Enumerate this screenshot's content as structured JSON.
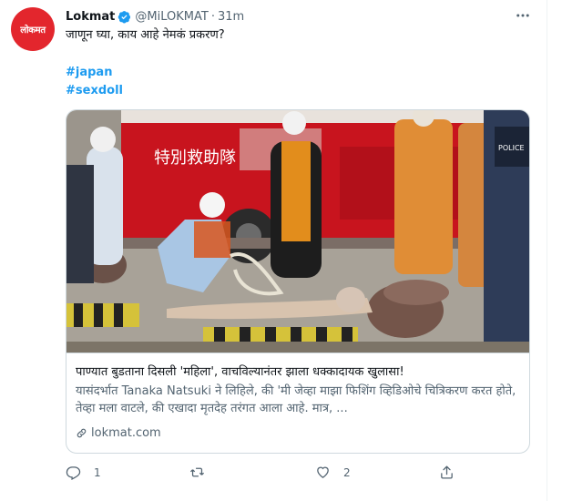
{
  "tweet": {
    "author": {
      "avatar_text": "लोकमत",
      "name": "Lokmat",
      "verified_icon": "verified-badge-icon",
      "handle": "@MiLOKMAT",
      "separator": "·",
      "time": "31m"
    },
    "more_icon": "ellipsis-icon",
    "text": "जाणून घ्या, काय आहे नेमकं प्रकरण?",
    "hashtags": [
      "#japan",
      "#sexdoll"
    ],
    "card": {
      "title": "पाण्यात बुडताना दिसली 'महिला', वाचविल्यानंतर झाला धक्कादायक खुलासा!",
      "description": "यासंदर्भात Tanaka Natsuki ने लिहिले, की 'मी जेव्हा माझा फिशिंग व्हिडिओचे चित्रिकरण करत होते, तेव्हा मला वाटले, की एखादा मृतदेह तरंगत आला आहे. मात्र, ...",
      "domain": "lokmat.com",
      "image_sign_text": "特別救助隊",
      "image_police_text": "POLICE"
    },
    "actions": {
      "reply": {
        "icon": "reply-icon",
        "count": "1"
      },
      "retweet": {
        "icon": "retweet-icon",
        "count": ""
      },
      "like": {
        "icon": "heart-icon",
        "count": "2"
      },
      "share": {
        "icon": "share-icon",
        "count": ""
      }
    }
  },
  "colors": {
    "accent": "#1d9bf0",
    "brand_red": "#e3262d",
    "secondary_text": "#536471",
    "border": "#cfd9de"
  }
}
